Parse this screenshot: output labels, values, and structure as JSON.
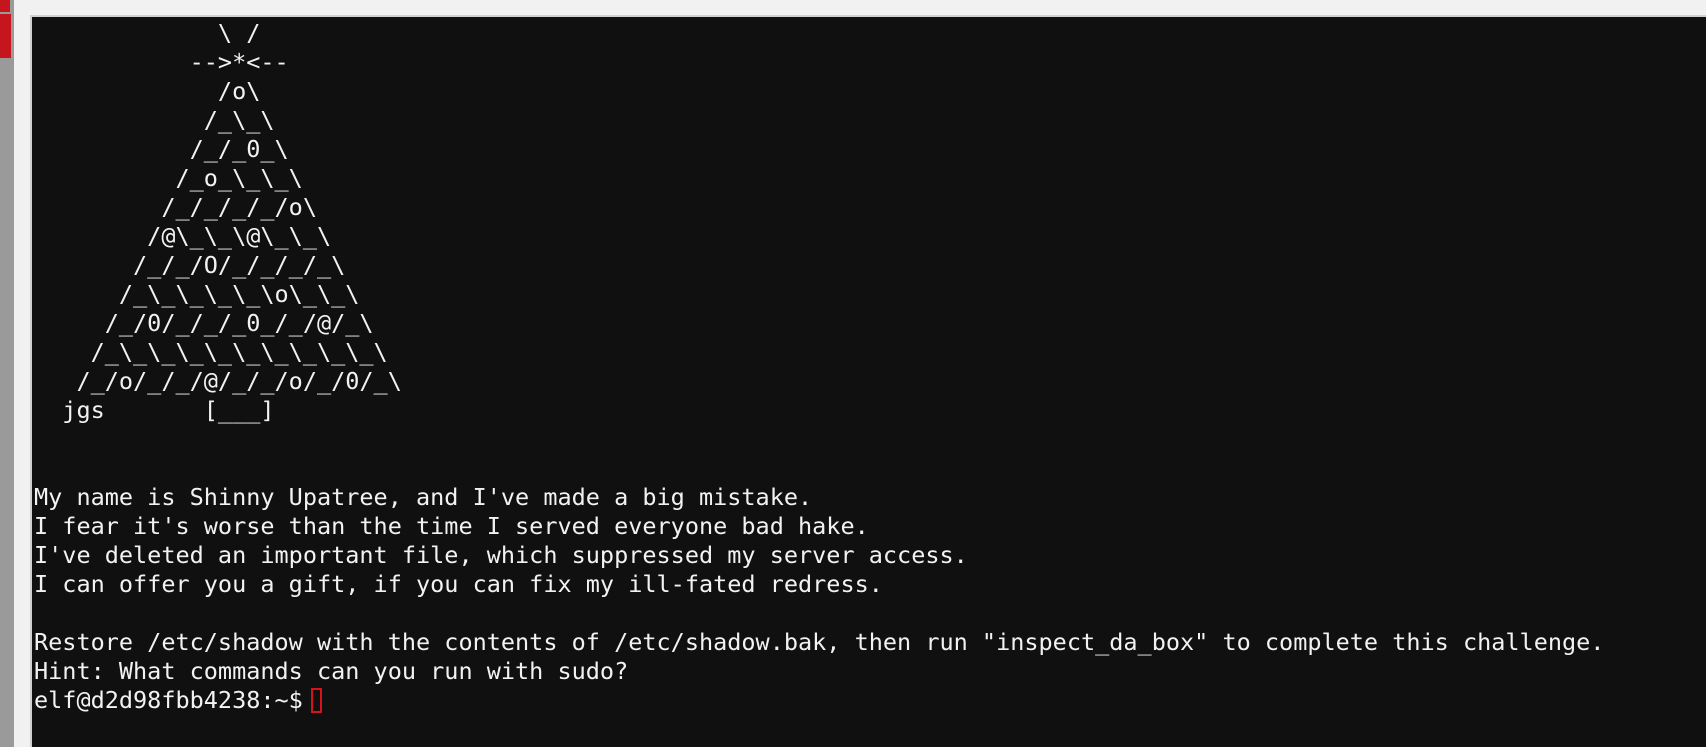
{
  "terminal": {
    "ascii_art": [
      "             \\ /",
      "           -->*<--",
      "             /o\\",
      "            /_\\_\\",
      "           /_/_0_\\",
      "          /_o_\\_\\_\\",
      "         /_/_/_/_/o\\",
      "        /@\\_\\_\\@\\_\\_\\",
      "       /_/_/O/_/_/_/_\\",
      "      /_\\_\\_\\_\\_\\o\\_\\_\\",
      "     /_/0/_/_/_0_/_/@/_\\",
      "    /_\\_\\_\\_\\_\\_\\_\\_\\_\\_\\",
      "   /_/o/_/_/@/_/_/o/_/0/_\\",
      "  jgs       [___]"
    ],
    "message_lines": [
      "My name is Shinny Upatree, and I've made a big mistake.",
      "I fear it's worse than the time I served everyone bad hake.",
      "I've deleted an important file, which suppressed my server access.",
      "I can offer you a gift, if you can fix my ill-fated redress.",
      "",
      "Restore /etc/shadow with the contents of /etc/shadow.bak, then run \"inspect_da_box\" to complete this challenge.",
      "Hint: What commands can you run with sudo?"
    ],
    "prompt": "elf@d2d98fbb4238:~$",
    "input_value": "",
    "colors": {
      "background": "#101010",
      "foreground": "#f2f2f2",
      "cursor": "#d8121a",
      "accent": "#c4161c"
    }
  }
}
